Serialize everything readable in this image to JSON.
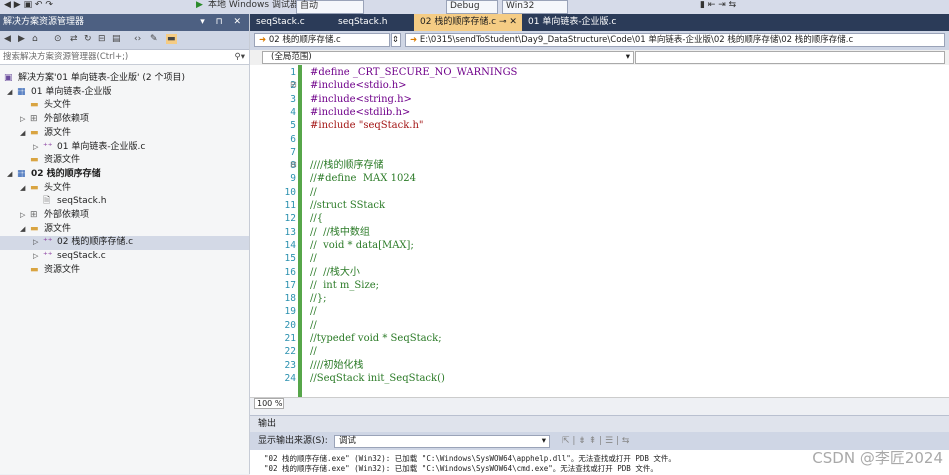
{
  "toolbar": {
    "platform_label": "本地 Windows 调试器",
    "mode_label": "自动",
    "config": "Debug",
    "platform": "Win32"
  },
  "solution_explorer": {
    "title": "解决方案资源管理器",
    "search_placeholder": "搜索解决方案资源管理器(Ctrl+;)",
    "tree": [
      {
        "label": "解决方案'01 单向链表-企业版' (2 个项目)",
        "level": 0,
        "icon": "solution-icon",
        "expand": ""
      },
      {
        "label": "01 单向链表-企业版",
        "level": 1,
        "icon": "project-icon",
        "expand": "open"
      },
      {
        "label": "头文件",
        "level": 2,
        "icon": "folder-icon",
        "expand": ""
      },
      {
        "label": "外部依赖项",
        "level": 2,
        "icon": "dependencies-icon",
        "expand": "closed"
      },
      {
        "label": "源文件",
        "level": 2,
        "icon": "folder-icon",
        "expand": "open"
      },
      {
        "label": "01 单向链表-企业版.c",
        "level": 3,
        "icon": "c-file-icon",
        "expand": "closed"
      },
      {
        "label": "资源文件",
        "level": 2,
        "icon": "folder-icon",
        "expand": ""
      },
      {
        "label": "02 栈的顺序存储",
        "level": 1,
        "icon": "project-icon",
        "expand": "open",
        "bold": true
      },
      {
        "label": "头文件",
        "level": 2,
        "icon": "folder-icon",
        "expand": "open"
      },
      {
        "label": "seqStack.h",
        "level": 3,
        "icon": "h-file-icon",
        "expand": ""
      },
      {
        "label": "外部依赖项",
        "level": 2,
        "icon": "dependencies-icon",
        "expand": "closed"
      },
      {
        "label": "源文件",
        "level": 2,
        "icon": "folder-icon",
        "expand": "open"
      },
      {
        "label": "02 栈的顺序存储.c",
        "level": 3,
        "icon": "c-file-icon",
        "expand": "closed",
        "selected": true
      },
      {
        "label": "seqStack.c",
        "level": 3,
        "icon": "c-file-icon",
        "expand": "closed"
      },
      {
        "label": "资源文件",
        "level": 2,
        "icon": "folder-icon",
        "expand": ""
      }
    ]
  },
  "tabs": [
    {
      "label": "seqStack.c",
      "active": false
    },
    {
      "label": "seqStack.h",
      "active": false
    },
    {
      "label": "02 栈的顺序存储.c",
      "active": true
    },
    {
      "label": "01 单向链表-企业版.c",
      "active": false
    }
  ],
  "navbar": {
    "project": "02 栈的顺序存储.c",
    "path": "E:\\0315\\sendToStudent\\Day9_DataStructure\\Code\\01 单向链表-企业版\\02 栈的顺序存储\\02 栈的顺序存储.c"
  },
  "scope": "(全局范围)",
  "code_lines": [
    {
      "n": "1",
      "text": "#define _CRT_SECURE_NO_WARNINGS",
      "cls": "pp"
    },
    {
      "n": "2",
      "text": "#include<stdio.h>",
      "cls": "pp"
    },
    {
      "n": "3",
      "text": "#include<string.h>",
      "cls": "pp"
    },
    {
      "n": "4",
      "text": "#include<stdlib.h>",
      "cls": "pp"
    },
    {
      "n": "5",
      "text": "#include \"seqStack.h\"",
      "cls": "str"
    },
    {
      "n": "6",
      "text": "",
      "cls": "plain"
    },
    {
      "n": "7",
      "text": "",
      "cls": "plain"
    },
    {
      "n": "8",
      "text": "////栈的顺序存储",
      "cls": "cmt"
    },
    {
      "n": "9",
      "text": "//#define  MAX 1024",
      "cls": "cmt"
    },
    {
      "n": "10",
      "text": "//",
      "cls": "cmt"
    },
    {
      "n": "11",
      "text": "//struct SStack",
      "cls": "cmt"
    },
    {
      "n": "12",
      "text": "//{",
      "cls": "cmt"
    },
    {
      "n": "13",
      "text": "//  //栈中数组",
      "cls": "cmt"
    },
    {
      "n": "14",
      "text": "//  void * data[MAX];",
      "cls": "cmt"
    },
    {
      "n": "15",
      "text": "//",
      "cls": "cmt"
    },
    {
      "n": "16",
      "text": "//  //栈大小",
      "cls": "cmt"
    },
    {
      "n": "17",
      "text": "//  int m_Size;",
      "cls": "cmt"
    },
    {
      "n": "18",
      "text": "//};",
      "cls": "cmt"
    },
    {
      "n": "19",
      "text": "//",
      "cls": "cmt"
    },
    {
      "n": "20",
      "text": "//",
      "cls": "cmt"
    },
    {
      "n": "21",
      "text": "//typedef void * SeqStack;",
      "cls": "cmt"
    },
    {
      "n": "22",
      "text": "//",
      "cls": "cmt"
    },
    {
      "n": "23",
      "text": "////初始化栈",
      "cls": "cmt"
    },
    {
      "n": "24",
      "text": "//SeqStack init_SeqStack()",
      "cls": "cmt"
    }
  ],
  "zoom": "100 %",
  "output": {
    "title": "输出",
    "source_label": "显示输出来源(S):",
    "source_value": "调试",
    "lines": [
      "\"02 栈的顺序存储.exe\" (Win32): 已加载 \"C:\\Windows\\SysWOW64\\apphelp.dll\"。无法查找或打开 PDB 文件。",
      "\"02 栈的顺序存储.exe\" (Win32): 已加载 \"C:\\Windows\\SysWOW64\\cmd.exe\"。无法查找或打开 PDB 文件。"
    ]
  },
  "watermark": "CSDN @李匠2024"
}
